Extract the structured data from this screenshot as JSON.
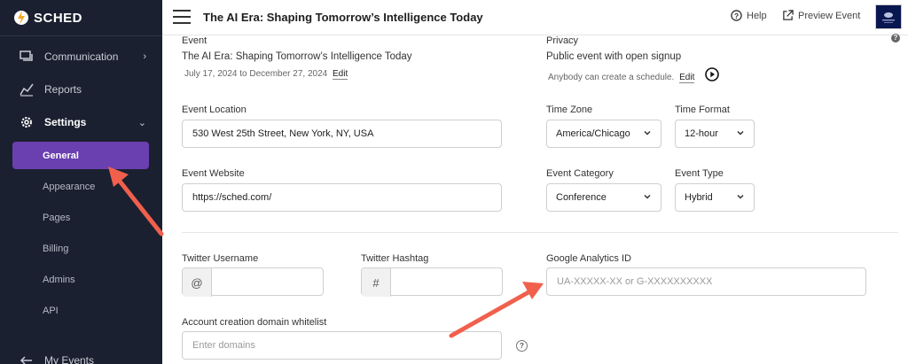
{
  "brand": {
    "name": "SCHED",
    "accent": "#f5a623"
  },
  "sidebar": {
    "items": [
      {
        "label": "Communication",
        "icon": "chat-icon"
      },
      {
        "label": "Reports",
        "icon": "chart-icon"
      },
      {
        "label": "Settings",
        "icon": "gear-icon"
      }
    ],
    "settings_sub": [
      "General",
      "Appearance",
      "Pages",
      "Billing",
      "Admins",
      "API"
    ],
    "bottom": {
      "label": "My Events",
      "icon": "back-arrow-icon"
    }
  },
  "topbar": {
    "title": "The AI Era: Shaping Tomorrow’s Intelligence Today",
    "help_label": "Help",
    "preview_label": "Preview Event"
  },
  "event": {
    "section_label": "Event",
    "name": "The AI Era: Shaping Tomorrow’s Intelligence Today",
    "dates": "July 17, 2024 to December 27, 2024",
    "edit_label": "Edit"
  },
  "privacy": {
    "section_label": "Privacy",
    "mode": "Public event with open signup",
    "note": "Anybody can create a schedule.",
    "edit_label": "Edit"
  },
  "location": {
    "label": "Event Location",
    "value": "530 West 25th Street, New York, NY, USA"
  },
  "timezone": {
    "label": "Time Zone",
    "value": "America/Chicago"
  },
  "timeformat": {
    "label": "Time Format",
    "value": "12-hour"
  },
  "website": {
    "label": "Event Website",
    "value": "https://sched.com/"
  },
  "category": {
    "label": "Event Category",
    "value": "Conference"
  },
  "eventtype": {
    "label": "Event Type",
    "value": "Hybrid"
  },
  "twitter_user": {
    "label": "Twitter Username",
    "prefix": "@",
    "value": ""
  },
  "twitter_tag": {
    "label": "Twitter Hashtag",
    "prefix": "#",
    "value": ""
  },
  "analytics": {
    "label": "Google Analytics ID",
    "placeholder": "UA-XXXXX-XX or G-XXXXXXXXXX"
  },
  "whitelist": {
    "label": "Account creation domain whitelist",
    "placeholder": "Enter domains"
  },
  "colors": {
    "sidebar": "#1b2030",
    "active": "#6a3fb0",
    "annotation_arrow": "#f0604d"
  }
}
